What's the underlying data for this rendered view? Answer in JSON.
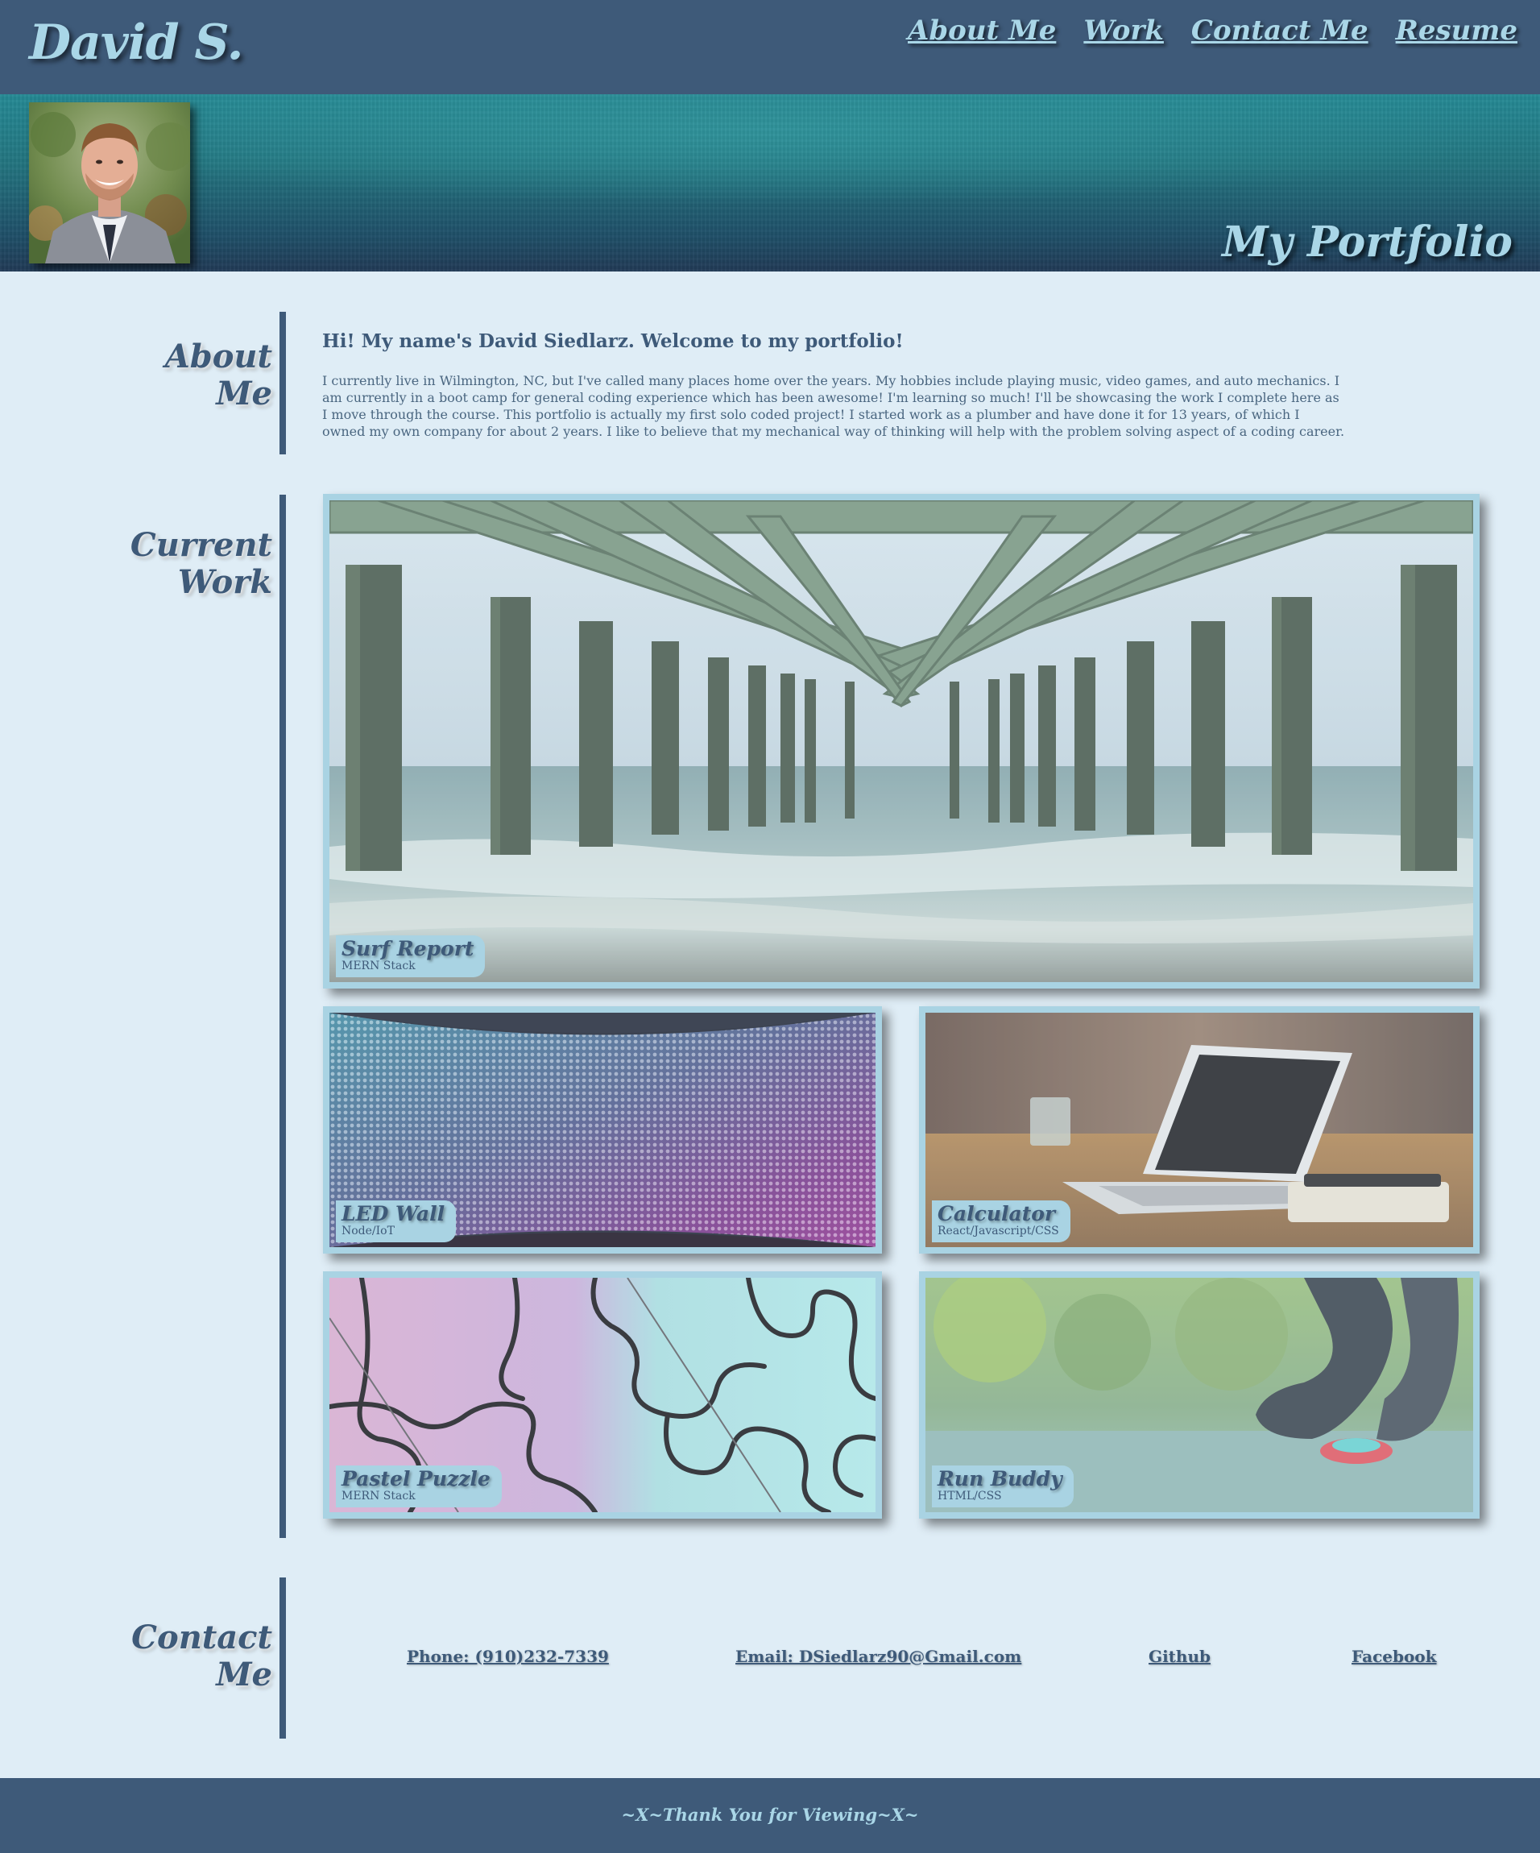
{
  "header": {
    "brand": "David S.",
    "nav": [
      "About Me",
      "Work",
      "Contact Me",
      "Resume"
    ]
  },
  "hero": {
    "title": "My Portfolio",
    "avatar_icon": "portrait-photo"
  },
  "about": {
    "heading_line1": "About",
    "heading_line2": "Me",
    "title": "Hi! My name's David Siedlarz. Welcome to my portfolio!",
    "body": "I currently live in Wilmington, NC, but I've called many places home over the years. My hobbies include playing music, video games, and auto mechanics. I am currently in a boot camp for general coding experience which has been awesome! I'm learning so much! I'll be showcasing the work I complete here as I move through the course. This portfolio is actually my first solo coded project! I started work as a plumber and have done it for 13 years, of which I owned my own company for about 2 years. I like to believe that my mechanical way of thinking will help with the problem solving aspect of a coding career."
  },
  "work": {
    "heading_line1": "Current",
    "heading_line2": "Work",
    "projects": [
      {
        "title": "Surf Report",
        "stack": "MERN Stack"
      },
      {
        "title": "LED Wall",
        "stack": "Node/IoT"
      },
      {
        "title": "Calculator",
        "stack": "React/Javascript/CSS"
      },
      {
        "title": "Pastel Puzzle",
        "stack": "MERN Stack"
      },
      {
        "title": "Run Buddy",
        "stack": "HTML/CSS"
      }
    ]
  },
  "contact": {
    "heading_line1": "Contact",
    "heading_line2": "Me",
    "phone": "Phone: (910)232-7339",
    "email": "Email: DSiedlarz90@Gmail.com",
    "github": "Github",
    "facebook": "Facebook"
  },
  "footer": {
    "text": "~X~Thank You for Viewing~X~"
  },
  "colors": {
    "header_bg": "#3e5a79",
    "accent_light": "#a9d6e7",
    "page_bg": "#dfedf6"
  }
}
